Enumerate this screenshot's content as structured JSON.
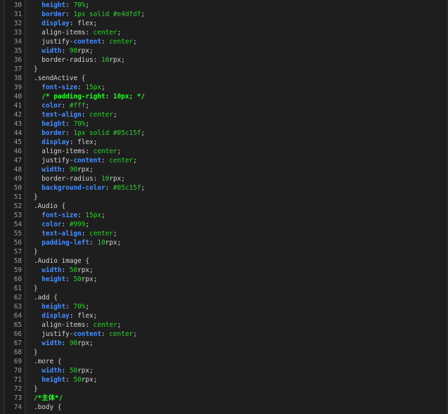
{
  "editor": {
    "lines": [
      {
        "num": "30",
        "segs": [
          {
            "t": "  ",
            "c": "t-plain"
          },
          {
            "t": "height",
            "c": "t-prop"
          },
          {
            "t": ": ",
            "c": "t-plain"
          },
          {
            "t": "70%",
            "c": "t-val"
          },
          {
            "t": ";",
            "c": "t-plain"
          }
        ]
      },
      {
        "num": "31",
        "segs": [
          {
            "t": "  ",
            "c": "t-plain"
          },
          {
            "t": "border",
            "c": "t-prop"
          },
          {
            "t": ": ",
            "c": "t-plain"
          },
          {
            "t": "1px solid #e4dfdf",
            "c": "t-val"
          },
          {
            "t": ";",
            "c": "t-plain"
          }
        ]
      },
      {
        "num": "32",
        "segs": [
          {
            "t": "  ",
            "c": "t-plain"
          },
          {
            "t": "display",
            "c": "t-prop"
          },
          {
            "t": ": flex;",
            "c": "t-plain"
          }
        ]
      },
      {
        "num": "33",
        "segs": [
          {
            "t": "  align-items: ",
            "c": "t-plain"
          },
          {
            "t": "center",
            "c": "t-val"
          },
          {
            "t": ";",
            "c": "t-plain"
          }
        ]
      },
      {
        "num": "34",
        "segs": [
          {
            "t": "  justify-",
            "c": "t-plain"
          },
          {
            "t": "content",
            "c": "t-prop"
          },
          {
            "t": ": ",
            "c": "t-plain"
          },
          {
            "t": "center",
            "c": "t-val"
          },
          {
            "t": ";",
            "c": "t-plain"
          }
        ]
      },
      {
        "num": "35",
        "segs": [
          {
            "t": "  ",
            "c": "t-plain"
          },
          {
            "t": "width",
            "c": "t-prop"
          },
          {
            "t": ": ",
            "c": "t-plain"
          },
          {
            "t": "90",
            "c": "t-val"
          },
          {
            "t": "rpx;",
            "c": "t-plain"
          }
        ]
      },
      {
        "num": "36",
        "segs": [
          {
            "t": "  border-radius: ",
            "c": "t-plain"
          },
          {
            "t": "10",
            "c": "t-val"
          },
          {
            "t": "rpx;",
            "c": "t-plain"
          }
        ]
      },
      {
        "num": "37",
        "segs": [
          {
            "t": "}",
            "c": "t-plain"
          }
        ]
      },
      {
        "num": "38",
        "segs": [
          {
            "t": ".sendActive {",
            "c": "t-plain"
          }
        ]
      },
      {
        "num": "39",
        "segs": [
          {
            "t": "  ",
            "c": "t-plain"
          },
          {
            "t": "font-size",
            "c": "t-prop"
          },
          {
            "t": ": ",
            "c": "t-plain"
          },
          {
            "t": "15px",
            "c": "t-val"
          },
          {
            "t": ";",
            "c": "t-plain"
          }
        ]
      },
      {
        "num": "40",
        "segs": [
          {
            "t": "  ",
            "c": "t-plain"
          },
          {
            "t": "/* padding-right: 10px; */",
            "c": "t-cmt"
          }
        ]
      },
      {
        "num": "41",
        "segs": [
          {
            "t": "  ",
            "c": "t-plain"
          },
          {
            "t": "color",
            "c": "t-prop"
          },
          {
            "t": ": ",
            "c": "t-plain"
          },
          {
            "t": "#fff",
            "c": "t-val"
          },
          {
            "t": ";",
            "c": "t-plain"
          }
        ]
      },
      {
        "num": "42",
        "segs": [
          {
            "t": "  ",
            "c": "t-plain"
          },
          {
            "t": "text-align",
            "c": "t-prop"
          },
          {
            "t": ": ",
            "c": "t-plain"
          },
          {
            "t": "center",
            "c": "t-val"
          },
          {
            "t": ";",
            "c": "t-plain"
          }
        ]
      },
      {
        "num": "43",
        "segs": [
          {
            "t": "  ",
            "c": "t-plain"
          },
          {
            "t": "height",
            "c": "t-prop"
          },
          {
            "t": ": ",
            "c": "t-plain"
          },
          {
            "t": "70%",
            "c": "t-val"
          },
          {
            "t": ";",
            "c": "t-plain"
          }
        ]
      },
      {
        "num": "44",
        "segs": [
          {
            "t": "  ",
            "c": "t-plain"
          },
          {
            "t": "border",
            "c": "t-prop"
          },
          {
            "t": ": ",
            "c": "t-plain"
          },
          {
            "t": "1px solid #05c15f",
            "c": "t-val"
          },
          {
            "t": ";",
            "c": "t-plain"
          }
        ]
      },
      {
        "num": "45",
        "segs": [
          {
            "t": "  ",
            "c": "t-plain"
          },
          {
            "t": "display",
            "c": "t-prop"
          },
          {
            "t": ": flex;",
            "c": "t-plain"
          }
        ]
      },
      {
        "num": "46",
        "segs": [
          {
            "t": "  align-items: ",
            "c": "t-plain"
          },
          {
            "t": "center",
            "c": "t-val"
          },
          {
            "t": ";",
            "c": "t-plain"
          }
        ]
      },
      {
        "num": "47",
        "segs": [
          {
            "t": "  justify-",
            "c": "t-plain"
          },
          {
            "t": "content",
            "c": "t-prop"
          },
          {
            "t": ": ",
            "c": "t-plain"
          },
          {
            "t": "center",
            "c": "t-val"
          },
          {
            "t": ";",
            "c": "t-plain"
          }
        ]
      },
      {
        "num": "48",
        "segs": [
          {
            "t": "  ",
            "c": "t-plain"
          },
          {
            "t": "width",
            "c": "t-prop"
          },
          {
            "t": ": ",
            "c": "t-plain"
          },
          {
            "t": "90",
            "c": "t-val"
          },
          {
            "t": "rpx;",
            "c": "t-plain"
          }
        ]
      },
      {
        "num": "49",
        "segs": [
          {
            "t": "  border-radius: ",
            "c": "t-plain"
          },
          {
            "t": "10",
            "c": "t-val"
          },
          {
            "t": "rpx;",
            "c": "t-plain"
          }
        ]
      },
      {
        "num": "50",
        "segs": [
          {
            "t": "  ",
            "c": "t-plain"
          },
          {
            "t": "background-color",
            "c": "t-prop"
          },
          {
            "t": ": ",
            "c": "t-plain"
          },
          {
            "t": "#05c15f",
            "c": "t-val"
          },
          {
            "t": ";",
            "c": "t-plain"
          }
        ]
      },
      {
        "num": "51",
        "segs": [
          {
            "t": "}",
            "c": "t-plain"
          }
        ]
      },
      {
        "num": "52",
        "segs": [
          {
            "t": ".Audio {",
            "c": "t-plain"
          }
        ]
      },
      {
        "num": "53",
        "segs": [
          {
            "t": "  ",
            "c": "t-plain"
          },
          {
            "t": "font-size",
            "c": "t-prop"
          },
          {
            "t": ": ",
            "c": "t-plain"
          },
          {
            "t": "15px",
            "c": "t-val"
          },
          {
            "t": ";",
            "c": "t-plain"
          }
        ]
      },
      {
        "num": "54",
        "segs": [
          {
            "t": "  ",
            "c": "t-plain"
          },
          {
            "t": "color",
            "c": "t-prop"
          },
          {
            "t": ": ",
            "c": "t-plain"
          },
          {
            "t": "#999",
            "c": "t-val"
          },
          {
            "t": ";",
            "c": "t-plain"
          }
        ]
      },
      {
        "num": "55",
        "segs": [
          {
            "t": "  ",
            "c": "t-plain"
          },
          {
            "t": "text-align",
            "c": "t-prop"
          },
          {
            "t": ": ",
            "c": "t-plain"
          },
          {
            "t": "center",
            "c": "t-val"
          },
          {
            "t": ";",
            "c": "t-plain"
          }
        ]
      },
      {
        "num": "56",
        "segs": [
          {
            "t": "  ",
            "c": "t-plain"
          },
          {
            "t": "padding-left",
            "c": "t-prop"
          },
          {
            "t": ": ",
            "c": "t-plain"
          },
          {
            "t": "10",
            "c": "t-val"
          },
          {
            "t": "rpx;",
            "c": "t-plain"
          }
        ]
      },
      {
        "num": "57",
        "segs": [
          {
            "t": "}",
            "c": "t-plain"
          }
        ]
      },
      {
        "num": "58",
        "segs": [
          {
            "t": ".Audio image {",
            "c": "t-plain"
          }
        ]
      },
      {
        "num": "59",
        "segs": [
          {
            "t": "  ",
            "c": "t-plain"
          },
          {
            "t": "width",
            "c": "t-prop"
          },
          {
            "t": ": ",
            "c": "t-plain"
          },
          {
            "t": "50",
            "c": "t-val"
          },
          {
            "t": "rpx;",
            "c": "t-plain"
          }
        ]
      },
      {
        "num": "60",
        "segs": [
          {
            "t": "  ",
            "c": "t-plain"
          },
          {
            "t": "height",
            "c": "t-prop"
          },
          {
            "t": ": ",
            "c": "t-plain"
          },
          {
            "t": "50",
            "c": "t-val"
          },
          {
            "t": "rpx;",
            "c": "t-plain"
          }
        ]
      },
      {
        "num": "61",
        "segs": [
          {
            "t": "}",
            "c": "t-plain"
          }
        ]
      },
      {
        "num": "62",
        "segs": [
          {
            "t": ".add {",
            "c": "t-plain"
          }
        ]
      },
      {
        "num": "63",
        "segs": [
          {
            "t": "  ",
            "c": "t-plain"
          },
          {
            "t": "height",
            "c": "t-prop"
          },
          {
            "t": ": ",
            "c": "t-plain"
          },
          {
            "t": "70%",
            "c": "t-val"
          },
          {
            "t": ";",
            "c": "t-plain"
          }
        ]
      },
      {
        "num": "64",
        "segs": [
          {
            "t": "  ",
            "c": "t-plain"
          },
          {
            "t": "display",
            "c": "t-prop"
          },
          {
            "t": ": flex;",
            "c": "t-plain"
          }
        ]
      },
      {
        "num": "65",
        "segs": [
          {
            "t": "  align-items: ",
            "c": "t-plain"
          },
          {
            "t": "center",
            "c": "t-val"
          },
          {
            "t": ";",
            "c": "t-plain"
          }
        ]
      },
      {
        "num": "66",
        "segs": [
          {
            "t": "  justify-",
            "c": "t-plain"
          },
          {
            "t": "content",
            "c": "t-prop"
          },
          {
            "t": ": ",
            "c": "t-plain"
          },
          {
            "t": "center",
            "c": "t-val"
          },
          {
            "t": ";",
            "c": "t-plain"
          }
        ]
      },
      {
        "num": "67",
        "segs": [
          {
            "t": "  ",
            "c": "t-plain"
          },
          {
            "t": "width",
            "c": "t-prop"
          },
          {
            "t": ": ",
            "c": "t-plain"
          },
          {
            "t": "90",
            "c": "t-val"
          },
          {
            "t": "rpx;",
            "c": "t-plain"
          }
        ]
      },
      {
        "num": "68",
        "segs": [
          {
            "t": "}",
            "c": "t-plain"
          }
        ]
      },
      {
        "num": "69",
        "segs": [
          {
            "t": ".more {",
            "c": "t-plain"
          }
        ]
      },
      {
        "num": "70",
        "segs": [
          {
            "t": "  ",
            "c": "t-plain"
          },
          {
            "t": "width",
            "c": "t-prop"
          },
          {
            "t": ": ",
            "c": "t-plain"
          },
          {
            "t": "50",
            "c": "t-val"
          },
          {
            "t": "rpx;",
            "c": "t-plain"
          }
        ]
      },
      {
        "num": "71",
        "segs": [
          {
            "t": "  ",
            "c": "t-plain"
          },
          {
            "t": "height",
            "c": "t-prop"
          },
          {
            "t": ": ",
            "c": "t-plain"
          },
          {
            "t": "50",
            "c": "t-val"
          },
          {
            "t": "rpx;",
            "c": "t-plain"
          }
        ]
      },
      {
        "num": "72",
        "segs": [
          {
            "t": "}",
            "c": "t-plain"
          }
        ]
      },
      {
        "num": "73",
        "segs": [
          {
            "t": "/*主体*/",
            "c": "t-cmt"
          }
        ]
      },
      {
        "num": "74",
        "segs": [
          {
            "t": ".body {",
            "c": "t-plain"
          }
        ]
      }
    ]
  }
}
